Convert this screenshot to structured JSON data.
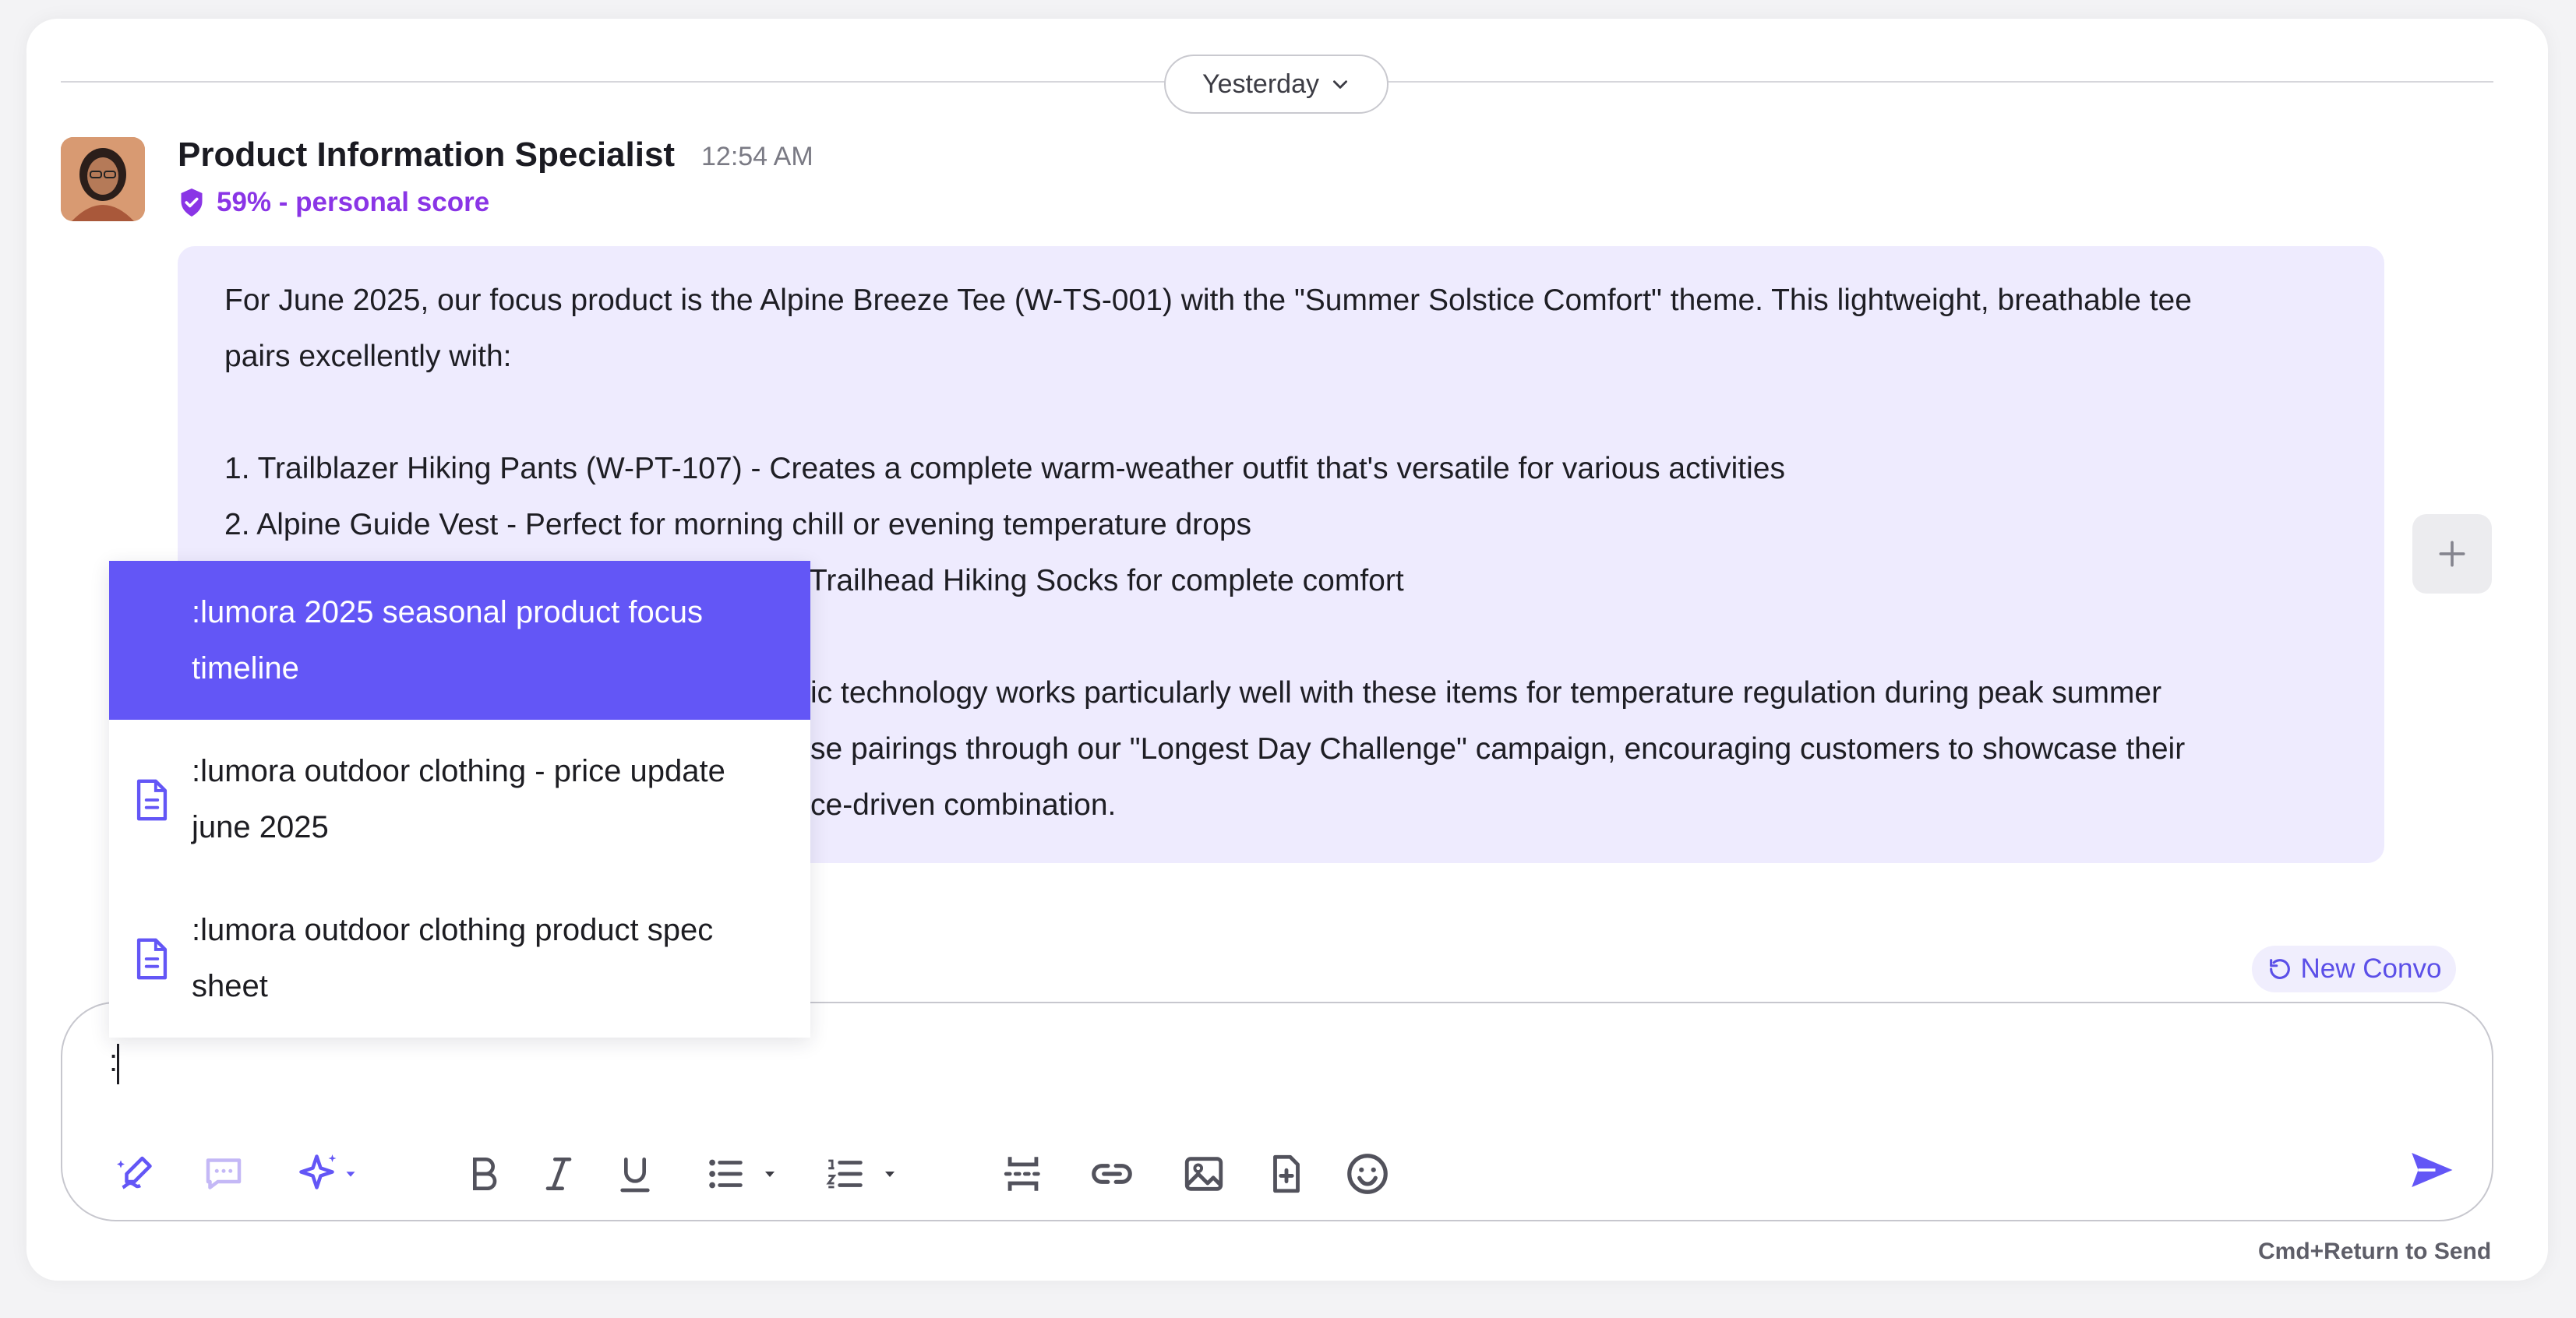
{
  "divider": {
    "date_label": "Yesterday"
  },
  "message": {
    "sender": "Product Information Specialist",
    "time": "12:54 AM",
    "score": "59% - personal score",
    "lines": [
      "For June 2025, our focus product is the Alpine Breeze Tee (W-TS-001) with the \"Summer Solstice Comfort\" theme. This lightweight, breathable tee",
      "pairs excellently with:",
      "1. Trailblazer Hiking Pants (W-PT-107) - Creates a complete warm-weather outfit that's versatile for various activities",
      "2. Alpine Guide Vest - Perfect for morning chill or evening temperature drops",
      "Trailhead Hiking Socks for complete comfort",
      "ic technology works particularly well with these items for temperature regulation during peak summer",
      "se pairings through our \"Longest Day Challenge\" campaign, encouraging customers to showcase their",
      "ce-driven combination."
    ]
  },
  "autocomplete": {
    "items": [
      {
        "label_1": ":lumora 2025 seasonal product focus",
        "label_2": "timeline",
        "icon": "none"
      },
      {
        "label_1": ":lumora outdoor clothing - price update",
        "label_2": "june 2025",
        "icon": "document-icon"
      },
      {
        "label_1": ":lumora outdoor clothing product spec",
        "label_2": "sheet",
        "icon": "document-icon"
      }
    ]
  },
  "new_convo_label": "New Convo",
  "composer": {
    "value": ":"
  },
  "toolbar": {
    "icons": [
      "ai-write-icon",
      "comment-icon",
      "sparkle-icon",
      "bold-icon",
      "italic-icon",
      "underline-icon",
      "bullet-list-icon",
      "numbered-list-icon",
      "page-break-icon",
      "link-icon",
      "image-icon",
      "file-add-icon",
      "emoji-icon",
      "send-icon"
    ]
  },
  "hint": "Cmd+Return to Send",
  "colors": {
    "accent": "#6356f6",
    "bubble": "#eeebfe",
    "score": "#8a35e6"
  }
}
